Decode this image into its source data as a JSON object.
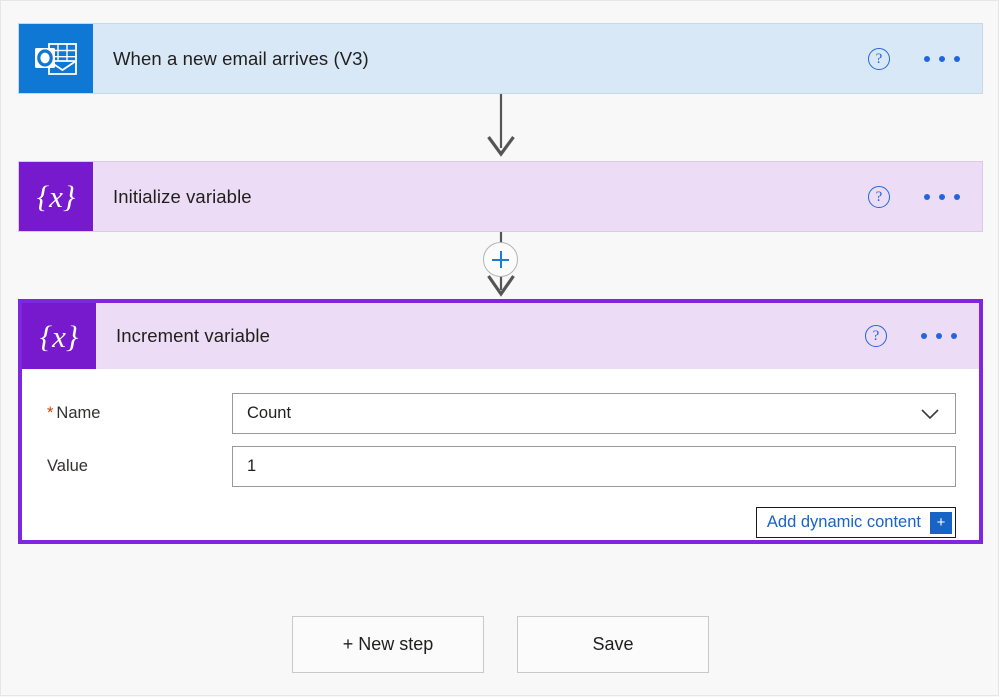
{
  "flow": {
    "trigger": {
      "title": "When a new email arrives (V3)",
      "icon": "outlook-icon",
      "help_icon": "help-icon",
      "menu_icon": "ellipsis-icon",
      "header_bg": "#d9e8f7",
      "icon_bg": "#0f78d4"
    },
    "initialize_action": {
      "title": "Initialize variable",
      "icon": "variable-icon",
      "icon_glyph": "{x}",
      "help_icon": "help-icon",
      "menu_icon": "ellipsis-icon",
      "header_bg": "#ecdcf5",
      "icon_bg": "#7719cd"
    },
    "increment_action": {
      "title": "Increment variable",
      "icon": "variable-icon",
      "icon_glyph": "{x}",
      "help_icon": "help-icon",
      "menu_icon": "ellipsis-icon",
      "header_bg": "#ecdcf5",
      "icon_bg": "#7719cd",
      "selected_border_color": "#8026e0",
      "fields": {
        "name": {
          "label": "Name",
          "required": true,
          "required_marker": "*",
          "value": "Count",
          "placeholder": "Name",
          "control": "dropdown",
          "chevron_icon": "chevron-down-icon"
        },
        "value": {
          "label": "Value",
          "required": false,
          "value": "1",
          "placeholder": "Value",
          "control": "textbox"
        }
      },
      "dynamic_content": {
        "label": "Add dynamic content",
        "plus_glyph": "+",
        "accent_color": "#1763c6"
      }
    },
    "insert_button": {
      "name": "insert-step-button",
      "glyph": "+",
      "accent_color": "#1a7fd4"
    }
  },
  "footer": {
    "new_step_label": "+ New step",
    "save_label": "Save"
  }
}
